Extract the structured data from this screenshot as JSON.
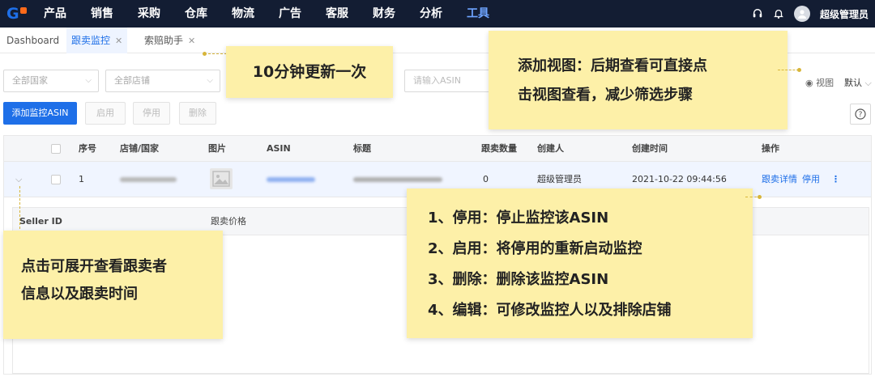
{
  "topnav": {
    "menu": [
      "产品",
      "销售",
      "采购",
      "仓库",
      "物流",
      "广告",
      "客服",
      "财务",
      "分析",
      "工具"
    ],
    "active_index": 9,
    "user_name": "超级管理员",
    "accent_color": "#1e6fe8",
    "bg_color": "#131d33"
  },
  "tabs": [
    {
      "label": "Dashboard",
      "closable": false,
      "active": false
    },
    {
      "label": "跟卖监控",
      "closable": true,
      "active": true
    },
    {
      "label": "索赔助手",
      "closable": true,
      "active": false
    }
  ],
  "filters": {
    "country_select": "全部国家",
    "shop_select": "全部店铺",
    "asin_placeholder": "请输入ASIN",
    "view_label": "视图",
    "default_label": "默认"
  },
  "actions": {
    "add_button": "添加监控ASIN",
    "enable_button": "启用",
    "disable_button": "停用",
    "delete_button": "删除"
  },
  "table": {
    "headers": [
      "序号",
      "店铺/国家",
      "图片",
      "ASIN",
      "标题",
      "跟卖数量",
      "创建人",
      "创建时间",
      "操作"
    ],
    "rows": [
      {
        "index": "1",
        "follow_count": "0",
        "creator": "超级管理员",
        "created_at": "2021-10-22 09:44:56",
        "detail_link": "跟卖详情",
        "disable_link": "停用"
      }
    ],
    "sub_headers": [
      "Seller ID",
      "跟卖价格"
    ]
  },
  "notes": {
    "update": "10分钟更新一次",
    "view": [
      "添加视图：后期查看可直接点",
      "击视图查看，减少筛选步骤"
    ],
    "expand": [
      "点击可展开查看跟卖者",
      "信息以及跟卖时间"
    ],
    "ops": [
      "1、停用：停止监控该ASIN",
      "2、启用：将停用的重新启动监控",
      "3、删除：删除该监控ASIN",
      "4、编辑：可修改监控人以及排除店铺"
    ],
    "note_color": "#fdf0a8"
  }
}
